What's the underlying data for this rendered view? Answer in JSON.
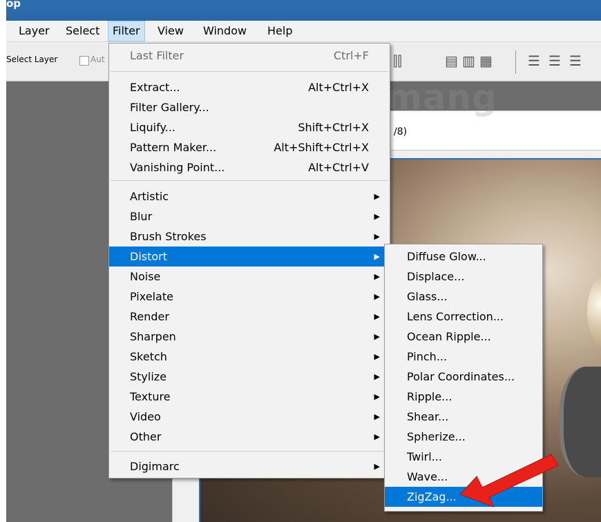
{
  "window": {
    "title_fragment": "op"
  },
  "menubar": {
    "items": [
      "Layer",
      "Select",
      "Filter",
      "View",
      "Window",
      "Help"
    ],
    "open_item": "Filter"
  },
  "options_bar": {
    "select_layer_label": "Select Layer",
    "auto_label": "Aut",
    "icons": [
      "align-icon-1",
      "align-icon-2",
      "align-icon-3",
      "align-icon-4",
      "align-icon-5",
      "distribute-icon-1",
      "distribute-icon-2",
      "distribute-icon-3"
    ]
  },
  "document": {
    "tab_text": "/8)"
  },
  "filter_menu": {
    "items": [
      {
        "label": "Last Filter",
        "shortcut": "Ctrl+F",
        "disabled": true
      },
      {
        "label": "Extract...",
        "shortcut": "Alt+Ctrl+X"
      },
      {
        "label": "Filter Gallery...",
        "shortcut": ""
      },
      {
        "label": "Liquify...",
        "shortcut": "Shift+Ctrl+X"
      },
      {
        "label": "Pattern Maker...",
        "shortcut": "Alt+Shift+Ctrl+X"
      },
      {
        "label": "Vanishing Point...",
        "shortcut": "Alt+Ctrl+V"
      },
      {
        "label": "Artistic",
        "submenu": true
      },
      {
        "label": "Blur",
        "submenu": true
      },
      {
        "label": "Brush Strokes",
        "submenu": true
      },
      {
        "label": "Distort",
        "submenu": true,
        "highlighted": true
      },
      {
        "label": "Noise",
        "submenu": true
      },
      {
        "label": "Pixelate",
        "submenu": true
      },
      {
        "label": "Render",
        "submenu": true
      },
      {
        "label": "Sharpen",
        "submenu": true
      },
      {
        "label": "Sketch",
        "submenu": true
      },
      {
        "label": "Stylize",
        "submenu": true
      },
      {
        "label": "Texture",
        "submenu": true
      },
      {
        "label": "Video",
        "submenu": true
      },
      {
        "label": "Other",
        "submenu": true
      },
      {
        "label": "Digimarc",
        "submenu": true
      }
    ]
  },
  "distort_menu": {
    "items": [
      {
        "label": "Diffuse Glow..."
      },
      {
        "label": "Displace..."
      },
      {
        "label": "Glass..."
      },
      {
        "label": "Lens Correction..."
      },
      {
        "label": "Ocean Ripple..."
      },
      {
        "label": "Pinch..."
      },
      {
        "label": "Polar Coordinates..."
      },
      {
        "label": "Ripple..."
      },
      {
        "label": "Shear..."
      },
      {
        "label": "Spherize..."
      },
      {
        "label": "Twirl..."
      },
      {
        "label": "Wave..."
      },
      {
        "label": "ZigZag...",
        "highlighted": true
      }
    ]
  },
  "watermark": {
    "text": "uantrimang",
    "logo": "quantrimang-bulb-logo"
  },
  "colors": {
    "highlight": "#0078d7",
    "menu_bg": "#f2f2f2",
    "annotation_arrow": "#e8211b"
  }
}
